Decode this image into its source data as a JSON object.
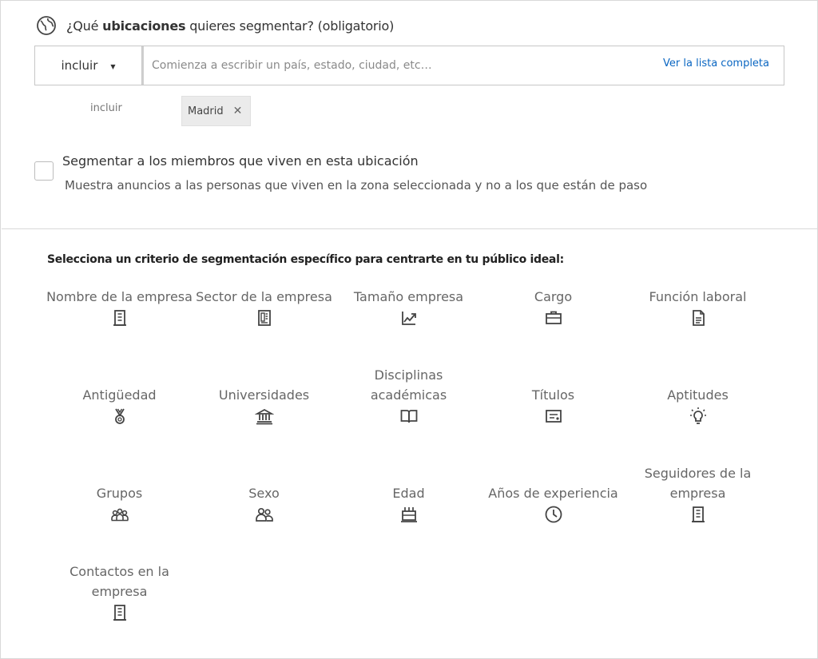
{
  "location": {
    "title_prefix": "¿Qué ",
    "title_bold": "ubicaciones",
    "title_suffix": " quieres segmentar? (obligatorio)",
    "include_select_value": "incluir",
    "search_placeholder": "Comienza a escribir un país, estado, ciudad, etc…",
    "view_all_link": "Ver la lista completa",
    "include_label": "incluir",
    "chips": [
      {
        "label": "Madrid"
      }
    ],
    "checkbox_title": "Segmentar a los miembros que viven en esta ubicación",
    "checkbox_description": "Muestra anuncios a las personas que viven en la zona seleccionada y no a los que están de paso",
    "checkbox_checked": false
  },
  "criteria": {
    "title": "Selecciona un criterio de segmentación específico para centrarte en tu público ideal:",
    "items": [
      {
        "label": "Nombre de la empresa",
        "icon": "building-icon"
      },
      {
        "label": "Sector de la empresa",
        "icon": "document-building-icon"
      },
      {
        "label": "Tamaño empresa",
        "icon": "chart-trend-icon"
      },
      {
        "label": "Cargo",
        "icon": "briefcase-icon"
      },
      {
        "label": "Función laboral",
        "icon": "document-icon"
      },
      {
        "label": "Antigüedad",
        "icon": "medal-icon"
      },
      {
        "label": "Universidades",
        "icon": "institution-icon"
      },
      {
        "label": "Disciplinas\nacadémicas",
        "icon": "book-icon"
      },
      {
        "label": "Títulos",
        "icon": "certificate-icon"
      },
      {
        "label": "Aptitudes",
        "icon": "lightbulb-icon"
      },
      {
        "label": "Grupos",
        "icon": "group-icon"
      },
      {
        "label": "Sexo",
        "icon": "people-icon"
      },
      {
        "label": "Edad",
        "icon": "cake-icon"
      },
      {
        "label": "Años de experiencia",
        "icon": "clock-icon"
      },
      {
        "label": "Seguidores de la\nempresa",
        "icon": "building-icon"
      },
      {
        "label": "Contactos en la\nempresa",
        "icon": "building-icon"
      }
    ]
  }
}
